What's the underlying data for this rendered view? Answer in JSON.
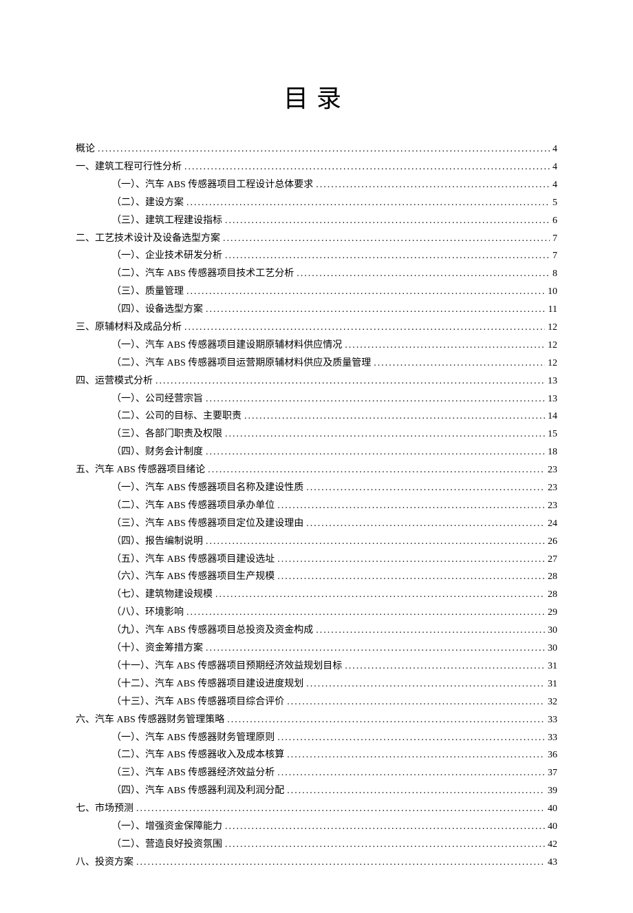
{
  "title": "目录",
  "entries": [
    {
      "level": 0,
      "label": "概论",
      "page": "4"
    },
    {
      "level": 0,
      "label": "一、建筑工程可行性分析",
      "page": "4"
    },
    {
      "level": 1,
      "label": "（一）、汽车 ABS 传感器项目工程设计总体要求",
      "page": "4"
    },
    {
      "level": 1,
      "label": "（二）、建设方案",
      "page": "5"
    },
    {
      "level": 1,
      "label": "（三）、建筑工程建设指标",
      "page": "6"
    },
    {
      "level": 0,
      "label": "二、工艺技术设计及设备选型方案",
      "page": "7"
    },
    {
      "level": 1,
      "label": "（一）、企业技术研发分析",
      "page": "7"
    },
    {
      "level": 1,
      "label": "（二）、汽车 ABS 传感器项目技术工艺分析",
      "page": "8"
    },
    {
      "level": 1,
      "label": "（三）、质量管理",
      "page": "10"
    },
    {
      "level": 1,
      "label": "（四）、设备选型方案",
      "page": "11"
    },
    {
      "level": 0,
      "label": "三、原辅材料及成品分析",
      "page": "12"
    },
    {
      "level": 1,
      "label": "（一）、汽车 ABS 传感器项目建设期原辅材料供应情况",
      "page": "12"
    },
    {
      "level": 1,
      "label": "（二）、汽车 ABS 传感器项目运营期原辅材料供应及质量管理",
      "page": "12"
    },
    {
      "level": 0,
      "label": "四、运营模式分析",
      "page": "13"
    },
    {
      "level": 1,
      "label": "（一）、公司经营宗旨",
      "page": "13"
    },
    {
      "level": 1,
      "label": "（二）、公司的目标、主要职责",
      "page": "14"
    },
    {
      "level": 1,
      "label": "（三）、各部门职责及权限",
      "page": "15"
    },
    {
      "level": 1,
      "label": "（四）、财务会计制度",
      "page": "18"
    },
    {
      "level": 0,
      "label": "五、汽车 ABS 传感器项目绪论",
      "page": "23"
    },
    {
      "level": 1,
      "label": "（一）、汽车 ABS 传感器项目名称及建设性质",
      "page": "23"
    },
    {
      "level": 1,
      "label": "（二）、汽车 ABS 传感器项目承办单位",
      "page": "23"
    },
    {
      "level": 1,
      "label": "（三）、汽车 ABS 传感器项目定位及建设理由",
      "page": "24"
    },
    {
      "level": 1,
      "label": "（四）、报告编制说明",
      "page": "26"
    },
    {
      "level": 1,
      "label": "（五）、汽车 ABS 传感器项目建设选址",
      "page": "27"
    },
    {
      "level": 1,
      "label": "（六）、汽车 ABS 传感器项目生产规模",
      "page": "28"
    },
    {
      "level": 1,
      "label": "（七）、建筑物建设规模",
      "page": "28"
    },
    {
      "level": 1,
      "label": "（八）、环境影响",
      "page": "29"
    },
    {
      "level": 1,
      "label": "（九）、汽车 ABS 传感器项目总投资及资金构成",
      "page": "30"
    },
    {
      "level": 1,
      "label": "（十）、资金筹措方案",
      "page": "30"
    },
    {
      "level": 1,
      "label": "（十一）、汽车 ABS 传感器项目预期经济效益规划目标",
      "page": "31"
    },
    {
      "level": 1,
      "label": "（十二）、汽车 ABS 传感器项目建设进度规划",
      "page": "31"
    },
    {
      "level": 1,
      "label": "（十三）、汽车 ABS 传感器项目综合评价",
      "page": "32"
    },
    {
      "level": 0,
      "label": "六、汽车 ABS 传感器财务管理策略",
      "page": "33"
    },
    {
      "level": 1,
      "label": "（一）、汽车 ABS 传感器财务管理原则",
      "page": "33"
    },
    {
      "level": 1,
      "label": "（二）、汽车 ABS 传感器收入及成本核算",
      "page": "36"
    },
    {
      "level": 1,
      "label": "（三）、汽车 ABS 传感器经济效益分析",
      "page": "37"
    },
    {
      "level": 1,
      "label": "（四）、汽车 ABS 传感器利润及利润分配",
      "page": "39"
    },
    {
      "level": 0,
      "label": "七、市场预测",
      "page": "40"
    },
    {
      "level": 1,
      "label": "（一）、增强资金保障能力",
      "page": "40"
    },
    {
      "level": 1,
      "label": "（二）、营造良好投资氛围",
      "page": "42"
    },
    {
      "level": 0,
      "label": "八、投资方案",
      "page": "43"
    }
  ]
}
